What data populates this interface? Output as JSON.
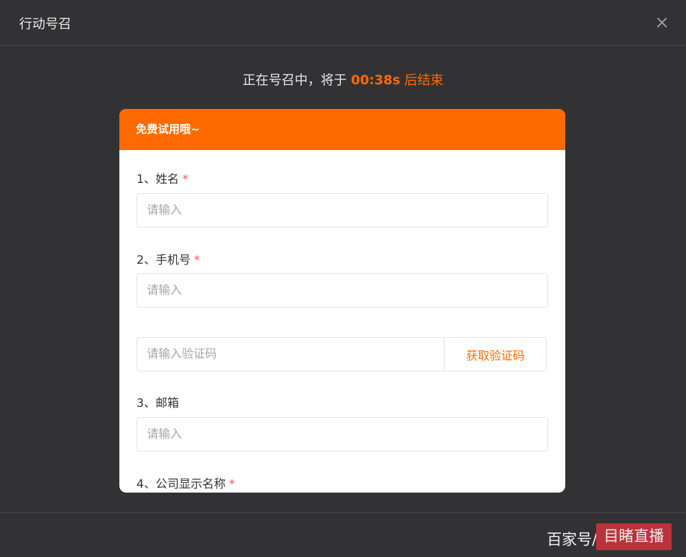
{
  "dialog": {
    "title": "行动号召",
    "close_glyph": "×"
  },
  "countdown": {
    "prefix": "正在号召中，将于 ",
    "time": "00:38s",
    "suffix": " 后结束"
  },
  "form": {
    "header": "免费试用哦~",
    "fields": [
      {
        "label": "1、姓名",
        "required_mark": "*",
        "placeholder": "请输入"
      },
      {
        "label": "2、手机号",
        "required_mark": "*",
        "placeholder": "请输入"
      },
      {
        "label": "3、邮箱",
        "placeholder": "请输入"
      },
      {
        "label": "4、公司显示名称",
        "required_mark": "*"
      }
    ],
    "verification": {
      "placeholder": "请输入验证码",
      "button_label": "获取验证码"
    }
  },
  "watermark": {
    "text": "百家号/",
    "badge": "目睹直播"
  },
  "colors": {
    "accent": "#ff6a00",
    "background": "#323234",
    "required": "#ff4d4f"
  }
}
